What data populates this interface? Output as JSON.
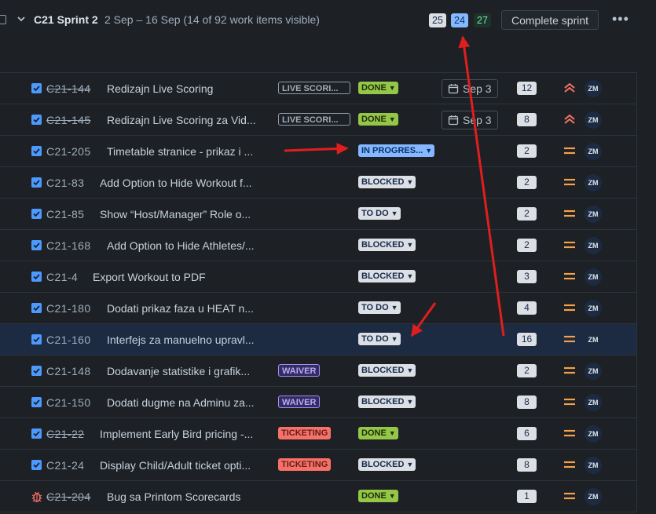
{
  "sprint": {
    "name": "C21 Sprint 2",
    "meta": "2 Sep – 16 Sep (14 of 92 work items visible)",
    "counts": [
      "25",
      "24",
      "27"
    ],
    "complete_label": "Complete sprint",
    "more_label": "•••",
    "assignee_initials": "ZM",
    "assignee_more": "•••"
  },
  "rows": [
    {
      "key": "C21-144",
      "strike": true,
      "title": "Redizajn Live Scoring",
      "label": "LIVE SCORI...",
      "label_type": "live",
      "status": "DONE",
      "status_type": "done",
      "date": "Sep 3",
      "points": "12",
      "priority": "highest",
      "assignee": "ZM"
    },
    {
      "key": "C21-145",
      "strike": true,
      "title": "Redizajn Live Scoring za Vid...",
      "label": "LIVE SCORI...",
      "label_type": "live",
      "status": "DONE",
      "status_type": "done",
      "date": "Sep 3",
      "points": "8",
      "priority": "highest",
      "assignee": "ZM"
    },
    {
      "key": "C21-205",
      "strike": false,
      "title": "Timetable stranice - prikaz i ...",
      "label": "",
      "label_type": "",
      "status": "IN PROGRES...",
      "status_type": "inprog",
      "date": "",
      "points": "2",
      "priority": "medium",
      "assignee": "ZM"
    },
    {
      "key": "C21-83",
      "strike": false,
      "title": "Add Option to Hide Workout f...",
      "label": "",
      "label_type": "",
      "status": "BLOCKED",
      "status_type": "blocked",
      "date": "",
      "points": "2",
      "priority": "medium",
      "assignee": "ZM"
    },
    {
      "key": "C21-85",
      "strike": false,
      "title": "Show “Host/Manager” Role o...",
      "label": "",
      "label_type": "",
      "status": "TO DO",
      "status_type": "todo",
      "date": "",
      "points": "2",
      "priority": "medium",
      "assignee": "ZM"
    },
    {
      "key": "C21-168",
      "strike": false,
      "title": "Add Option to Hide Athletes/...",
      "label": "",
      "label_type": "",
      "status": "BLOCKED",
      "status_type": "blocked",
      "date": "",
      "points": "2",
      "priority": "medium",
      "assignee": "ZM"
    },
    {
      "key": "C21-4",
      "strike": false,
      "title": "Export Workout to PDF",
      "label": "",
      "label_type": "",
      "status": "BLOCKED",
      "status_type": "blocked",
      "date": "",
      "points": "3",
      "priority": "medium",
      "assignee": "ZM"
    },
    {
      "key": "C21-180",
      "strike": false,
      "title": "Dodati prikaz faza u HEAT n...",
      "label": "",
      "label_type": "",
      "status": "TO DO",
      "status_type": "todo",
      "date": "",
      "points": "4",
      "priority": "medium",
      "assignee": "ZM"
    },
    {
      "key": "C21-160",
      "strike": false,
      "title": "Interfejs za manuelno upravl...",
      "label": "",
      "label_type": "",
      "status": "TO DO",
      "status_type": "todo",
      "date": "",
      "points": "16",
      "priority": "medium",
      "assignee": "ZM",
      "selected": true
    },
    {
      "key": "C21-148",
      "strike": false,
      "title": "Dodavanje statistike i grafik...",
      "label": "WAIVER",
      "label_type": "waiver",
      "status": "BLOCKED",
      "status_type": "blocked",
      "date": "",
      "points": "2",
      "priority": "medium",
      "assignee": "ZM"
    },
    {
      "key": "C21-150",
      "strike": false,
      "title": "Dodati dugme na Adminu za...",
      "label": "WAIVER",
      "label_type": "waiver",
      "status": "BLOCKED",
      "status_type": "blocked",
      "date": "",
      "points": "8",
      "priority": "medium",
      "assignee": "ZM"
    },
    {
      "key": "C21-22",
      "strike": true,
      "title": "Implement Early Bird pricing -...",
      "label": "TICKETING",
      "label_type": "ticketing",
      "status": "DONE",
      "status_type": "done",
      "date": "",
      "points": "6",
      "priority": "medium",
      "assignee": "ZM"
    },
    {
      "key": "C21-24",
      "strike": false,
      "title": "Display Child/Adult ticket opti...",
      "label": "TICKETING",
      "label_type": "ticketing",
      "status": "BLOCKED",
      "status_type": "blocked",
      "date": "",
      "points": "8",
      "priority": "medium",
      "assignee": "ZM"
    },
    {
      "key": "C21-204",
      "strike": true,
      "title": "Bug sa Printom Scorecards",
      "label": "",
      "label_type": "",
      "status": "DONE",
      "status_type": "done",
      "date": "",
      "points": "1",
      "priority": "medium",
      "assignee": "ZM",
      "type": "bug"
    }
  ],
  "colors": {
    "accent": "#4c9aff",
    "annotation_arrow": "#e01e1e",
    "priority_medium": "#f5a04a",
    "priority_highest": "#f87168"
  },
  "icons": {
    "expand": "chevron-down-icon",
    "checkbox": "checkbox-checked-icon",
    "bug": "bug-icon",
    "calendar": "calendar-icon",
    "priority_medium": "priority-medium-icon",
    "priority_highest": "priority-highest-icon"
  }
}
